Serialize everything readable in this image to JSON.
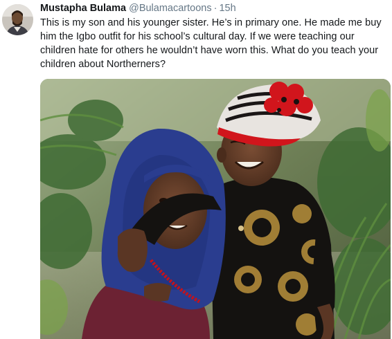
{
  "tweet": {
    "author": {
      "display_name": "Mustapha Bulama",
      "handle": "@Bulamacartoons",
      "avatar_icon": "user-avatar-photo"
    },
    "separator": "·",
    "timestamp": "15h",
    "text": "This is my son and his younger sister. He’s in primary one. He made me buy him the Igbo outfit for his school’s cultural day. If we were teaching our children hate for others he wouldn’t have worn this. What do you teach your children about Northerners?"
  },
  "media": {
    "icon": "tweet-photo-image"
  }
}
